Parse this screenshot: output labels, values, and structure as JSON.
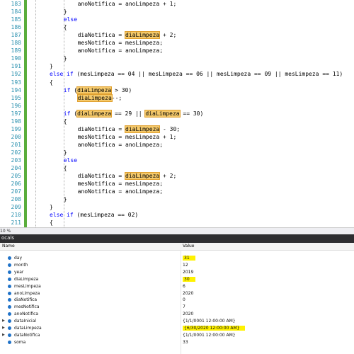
{
  "editor": {
    "lines": [
      {
        "n": "183",
        "indent": 7,
        "tokens": [
          {
            "t": "anoNotifica = anoLimpeza + 1;",
            "c": ""
          }
        ]
      },
      {
        "n": "184",
        "indent": 6,
        "tokens": [
          {
            "t": "}",
            "c": ""
          }
        ]
      },
      {
        "n": "185",
        "indent": 6,
        "tokens": [
          {
            "t": "else",
            "c": "kw"
          }
        ]
      },
      {
        "n": "186",
        "indent": 6,
        "tokens": [
          {
            "t": "{",
            "c": ""
          }
        ]
      },
      {
        "n": "187",
        "indent": 7,
        "tokens": [
          {
            "t": "diaNotifica = ",
            "c": ""
          },
          {
            "t": "diaLimpeza",
            "c": "hl"
          },
          {
            "t": " + 2;",
            "c": ""
          }
        ]
      },
      {
        "n": "188",
        "indent": 7,
        "tokens": [
          {
            "t": "mesNotifica = mesLimpeza;",
            "c": ""
          }
        ]
      },
      {
        "n": "189",
        "indent": 7,
        "tokens": [
          {
            "t": "anoNotifica = anoLimpeza;",
            "c": ""
          }
        ]
      },
      {
        "n": "190",
        "indent": 6,
        "tokens": [
          {
            "t": "}",
            "c": ""
          }
        ]
      },
      {
        "n": "191",
        "indent": 5,
        "tokens": [
          {
            "t": "}",
            "c": ""
          }
        ]
      },
      {
        "n": "192",
        "indent": 5,
        "tokens": [
          {
            "t": "else if",
            "c": "kw"
          },
          {
            "t": " (mesLimpeza == 04 || mesLimpeza == 06 || mesLimpeza == 09 || mesLimpeza == 11)",
            "c": ""
          }
        ]
      },
      {
        "n": "193",
        "indent": 5,
        "tokens": [
          {
            "t": "{",
            "c": ""
          }
        ]
      },
      {
        "n": "194",
        "indent": 6,
        "tokens": [
          {
            "t": "if",
            "c": "kw"
          },
          {
            "t": " (",
            "c": ""
          },
          {
            "t": "diaLimpeza",
            "c": "hl"
          },
          {
            "t": " > 30)",
            "c": ""
          }
        ]
      },
      {
        "n": "195",
        "indent": 7,
        "tokens": [
          {
            "t": "diaLimpeza",
            "c": "hl"
          },
          {
            "t": "--;",
            "c": ""
          }
        ]
      },
      {
        "n": "196",
        "indent": 0,
        "tokens": []
      },
      {
        "n": "197",
        "indent": 6,
        "tokens": [
          {
            "t": "if",
            "c": "kw"
          },
          {
            "t": " (",
            "c": ""
          },
          {
            "t": "diaLimpeza",
            "c": "hl"
          },
          {
            "t": " == 29 || ",
            "c": ""
          },
          {
            "t": "diaLimpeza",
            "c": "hl"
          },
          {
            "t": " == 30)",
            "c": ""
          }
        ]
      },
      {
        "n": "198",
        "indent": 6,
        "tokens": [
          {
            "t": "{",
            "c": ""
          }
        ]
      },
      {
        "n": "199",
        "indent": 7,
        "tokens": [
          {
            "t": "diaNotifica = ",
            "c": ""
          },
          {
            "t": "diaLimpeza",
            "c": "hl"
          },
          {
            "t": " - 30;",
            "c": ""
          }
        ]
      },
      {
        "n": "200",
        "indent": 7,
        "tokens": [
          {
            "t": "mesNotifica = mesLimpeza + 1;",
            "c": ""
          }
        ]
      },
      {
        "n": "201",
        "indent": 7,
        "tokens": [
          {
            "t": "anoNotifica = anoLimpeza;",
            "c": ""
          }
        ]
      },
      {
        "n": "202",
        "indent": 6,
        "tokens": [
          {
            "t": "}",
            "c": ""
          }
        ]
      },
      {
        "n": "203",
        "indent": 6,
        "tokens": [
          {
            "t": "else",
            "c": "kw"
          }
        ]
      },
      {
        "n": "204",
        "indent": 6,
        "tokens": [
          {
            "t": "{",
            "c": ""
          }
        ]
      },
      {
        "n": "205",
        "indent": 7,
        "tokens": [
          {
            "t": "diaNotifica = ",
            "c": ""
          },
          {
            "t": "diaLimpeza",
            "c": "hl"
          },
          {
            "t": " + 2;",
            "c": ""
          }
        ]
      },
      {
        "n": "206",
        "indent": 7,
        "tokens": [
          {
            "t": "mesNotifica = mesLimpeza;",
            "c": ""
          }
        ]
      },
      {
        "n": "207",
        "indent": 7,
        "tokens": [
          {
            "t": "anoNotifica = anoLimpeza;",
            "c": ""
          }
        ]
      },
      {
        "n": "208",
        "indent": 6,
        "tokens": [
          {
            "t": "}",
            "c": ""
          }
        ]
      },
      {
        "n": "209",
        "indent": 5,
        "tokens": [
          {
            "t": "}",
            "c": ""
          }
        ]
      },
      {
        "n": "210",
        "indent": 5,
        "tokens": [
          {
            "t": "else if",
            "c": "kw"
          },
          {
            "t": " (mesLimpeza == 02)",
            "c": ""
          }
        ]
      },
      {
        "n": "211",
        "indent": 5,
        "tokens": [
          {
            "t": "{",
            "c": ""
          }
        ]
      }
    ],
    "zoom": "10 %"
  },
  "locals": {
    "title": "ocals",
    "col_name": "Name",
    "col_value": "Value",
    "rows": [
      {
        "name": "day",
        "value": "31",
        "expandable": false,
        "highlight": true
      },
      {
        "name": "month",
        "value": "12",
        "expandable": false,
        "highlight": false
      },
      {
        "name": "year",
        "value": "2019",
        "expandable": false,
        "highlight": false
      },
      {
        "name": "diaLimpeza",
        "value": "30",
        "expandable": false,
        "highlight": true
      },
      {
        "name": "mesLimpeza",
        "value": "6",
        "expandable": false,
        "highlight": false
      },
      {
        "name": "anoLimpeza",
        "value": "2020",
        "expandable": false,
        "highlight": false
      },
      {
        "name": "diaNotifica",
        "value": "0",
        "expandable": false,
        "highlight": false
      },
      {
        "name": "mesNotifica",
        "value": "7",
        "expandable": false,
        "highlight": false
      },
      {
        "name": "anoNotifica",
        "value": "2020",
        "expandable": false,
        "highlight": false
      },
      {
        "name": "dataInicial",
        "value": "{1/1/0001 12:00:00 AM}",
        "expandable": true,
        "highlight": false
      },
      {
        "name": "dataLimpeza",
        "value": "{6/30/2020 12:00:00 AM}",
        "expandable": true,
        "highlight": true
      },
      {
        "name": "dataNotifica",
        "value": "{1/1/0001 12:00:00 AM}",
        "expandable": true,
        "highlight": false
      },
      {
        "name": "soma",
        "value": "33",
        "expandable": false,
        "highlight": false
      }
    ]
  },
  "colors": {
    "keyword": "#0000ff",
    "line_number": "#2b91af",
    "change_bar": "#5aad3c",
    "highlight": "#f5c96a",
    "value_highlight": "#fff200"
  }
}
